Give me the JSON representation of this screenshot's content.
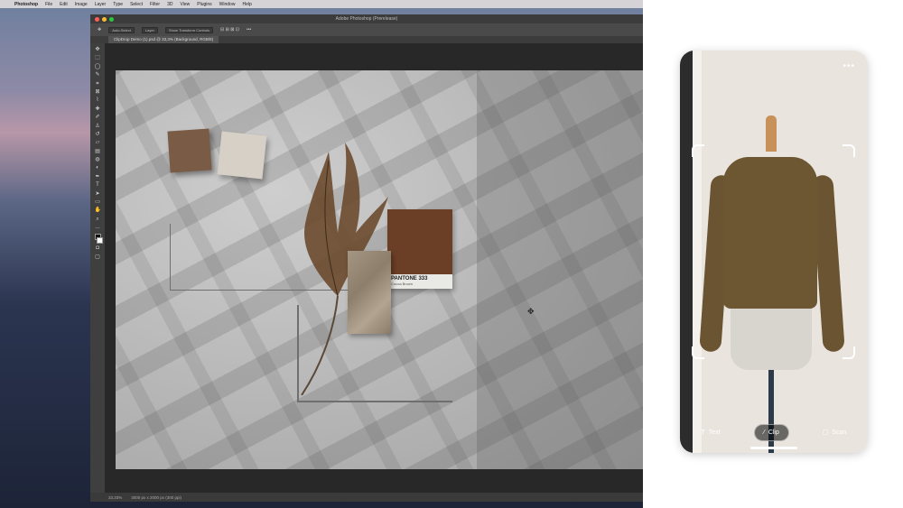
{
  "menubar": {
    "apple_icon": "apple-icon",
    "app_name": "Photoshop",
    "items": [
      "File",
      "Edit",
      "Image",
      "Layer",
      "Type",
      "Select",
      "Filter",
      "3D",
      "View",
      "Plugins",
      "Window",
      "Help"
    ]
  },
  "photoshop": {
    "window_title": "Adobe Photoshop (Prerelease)",
    "options": {
      "auto_select_label": "Auto-Select",
      "auto_select_value": "Layer",
      "transform_controls": "Show Transform Controls"
    },
    "document_tab": "ClipDrop Demo (1).psd @ 33,3% (Background, RGB/8)",
    "status": {
      "zoom": "33,33%",
      "doc_size": "3000 px x 2000 px (300 ppi)"
    },
    "canvas": {
      "pantone_title": "PANTONE 333",
      "pantone_name": "Cocoa Brown"
    }
  },
  "phone": {
    "more_icon": "more-horizontal-icon",
    "tabs": [
      {
        "label": "Text",
        "icon": "text-icon",
        "active": false
      },
      {
        "label": "Clip",
        "icon": "magic-wand-icon",
        "active": true
      },
      {
        "label": "Scan",
        "icon": "scan-icon",
        "active": false
      }
    ]
  },
  "colors": {
    "pantone": "#6b3f26",
    "jacket": "#6d5733",
    "ps_panel": "#535353"
  }
}
